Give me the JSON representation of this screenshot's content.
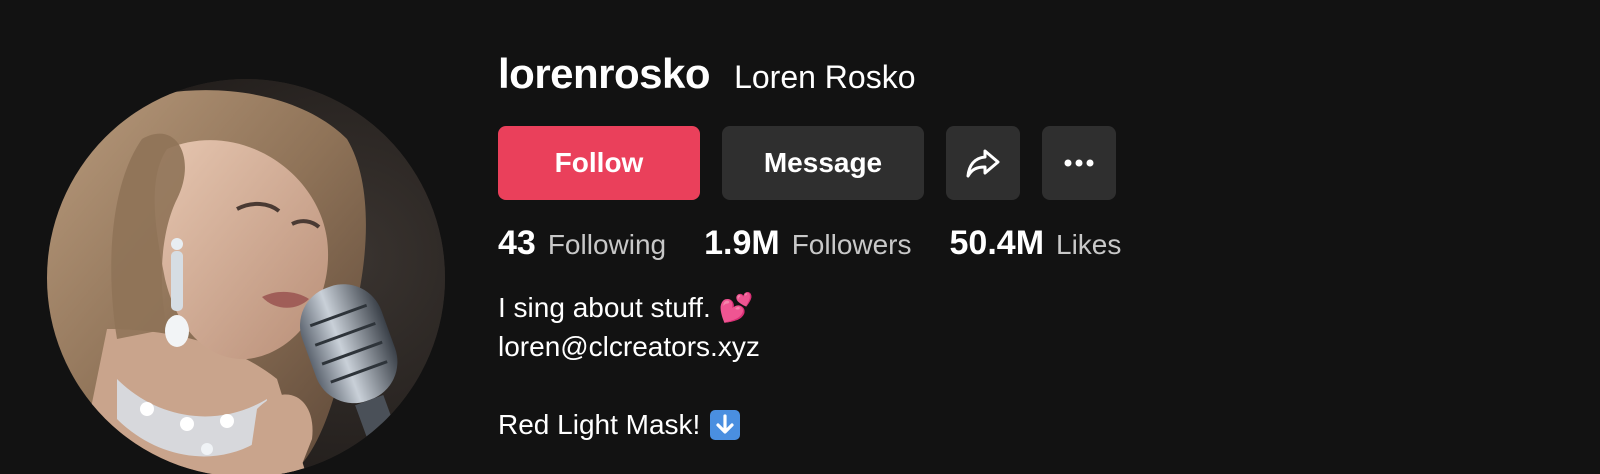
{
  "profile": {
    "username": "lorenrosko",
    "nickname": "Loren Rosko"
  },
  "actions": {
    "follow_label": "Follow",
    "message_label": "Message",
    "share_icon": "share-icon",
    "more_icon": "more-icon"
  },
  "stats": [
    {
      "value": "43",
      "label": "Following"
    },
    {
      "value": "1.9M",
      "label": "Followers"
    },
    {
      "value": "50.4M",
      "label": "Likes"
    }
  ],
  "bio": {
    "line1": "I sing about stuff.",
    "line1_emoji": "💕",
    "line2": "loren@clcreators.xyz",
    "line4": "Red Light Mask!",
    "line4_emoji": "down-arrow-icon"
  },
  "colors": {
    "background": "#121212",
    "follow": "#ea405b",
    "secondary_button": "#2f2f2f"
  }
}
